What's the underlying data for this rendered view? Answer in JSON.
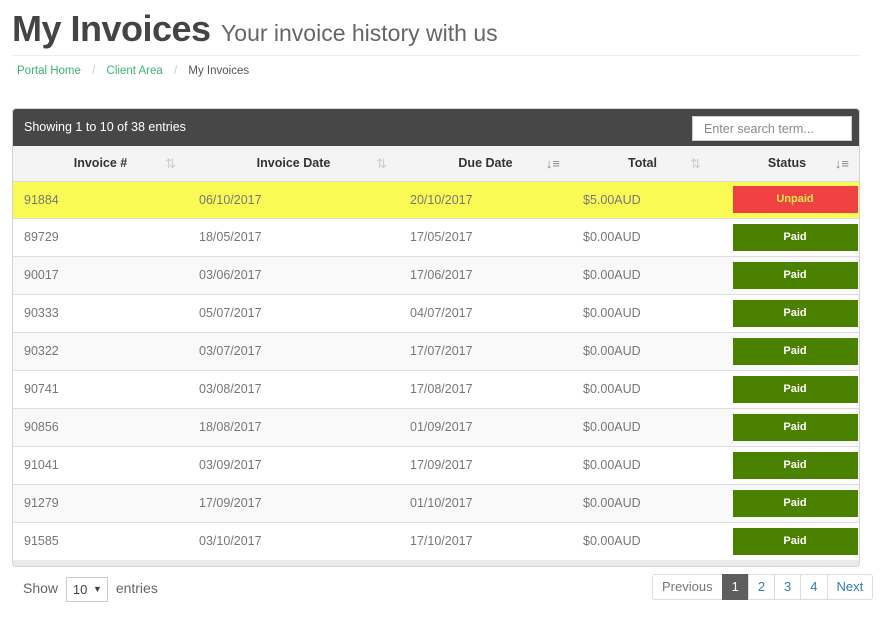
{
  "header": {
    "title": "My Invoices",
    "subtitle": "Your invoice history with us"
  },
  "breadcrumb": [
    {
      "label": "Portal Home"
    },
    {
      "label": "Client Area"
    },
    {
      "label": "My Invoices"
    }
  ],
  "table_bar": {
    "info": "Showing 1 to 10 of 38 entries",
    "search_placeholder": "Enter search term..."
  },
  "columns": [
    {
      "label": "Invoice #",
      "sort_icon": "sort-both-icon"
    },
    {
      "label": "Invoice Date",
      "sort_icon": "sort-both-icon"
    },
    {
      "label": "Due Date",
      "sort_icon": "sort-amount-asc-icon"
    },
    {
      "label": "Total",
      "sort_icon": "sort-both-icon"
    },
    {
      "label": "Status",
      "sort_icon": "sort-alpha-desc-icon"
    }
  ],
  "rows": [
    {
      "invoice": "91884",
      "invoice_date": "06/10/2017",
      "due_date": "20/10/2017",
      "total": "$5.00AUD",
      "status": "Unpaid"
    },
    {
      "invoice": "89729",
      "invoice_date": "18/05/2017",
      "due_date": "17/05/2017",
      "total": "$0.00AUD",
      "status": "Paid"
    },
    {
      "invoice": "90017",
      "invoice_date": "03/06/2017",
      "due_date": "17/06/2017",
      "total": "$0.00AUD",
      "status": "Paid"
    },
    {
      "invoice": "90333",
      "invoice_date": "05/07/2017",
      "due_date": "04/07/2017",
      "total": "$0.00AUD",
      "status": "Paid"
    },
    {
      "invoice": "90322",
      "invoice_date": "03/07/2017",
      "due_date": "17/07/2017",
      "total": "$0.00AUD",
      "status": "Paid"
    },
    {
      "invoice": "90741",
      "invoice_date": "03/08/2017",
      "due_date": "17/08/2017",
      "total": "$0.00AUD",
      "status": "Paid"
    },
    {
      "invoice": "90856",
      "invoice_date": "18/08/2017",
      "due_date": "01/09/2017",
      "total": "$0.00AUD",
      "status": "Paid"
    },
    {
      "invoice": "91041",
      "invoice_date": "03/09/2017",
      "due_date": "17/09/2017",
      "total": "$0.00AUD",
      "status": "Paid"
    },
    {
      "invoice": "91279",
      "invoice_date": "17/09/2017",
      "due_date": "01/10/2017",
      "total": "$0.00AUD",
      "status": "Paid"
    },
    {
      "invoice": "91585",
      "invoice_date": "03/10/2017",
      "due_date": "17/10/2017",
      "total": "$0.00AUD",
      "status": "Paid"
    }
  ],
  "status_colors": {
    "Paid": "#4a8200",
    "Unpaid": "#ef4142",
    "highlight_row": "#fafa55"
  },
  "length": {
    "prefix": "Show",
    "value": "10",
    "suffix": "entries"
  },
  "pagination": {
    "previous": "Previous",
    "pages": [
      "1",
      "2",
      "3",
      "4"
    ],
    "current": "1",
    "next": "Next"
  }
}
